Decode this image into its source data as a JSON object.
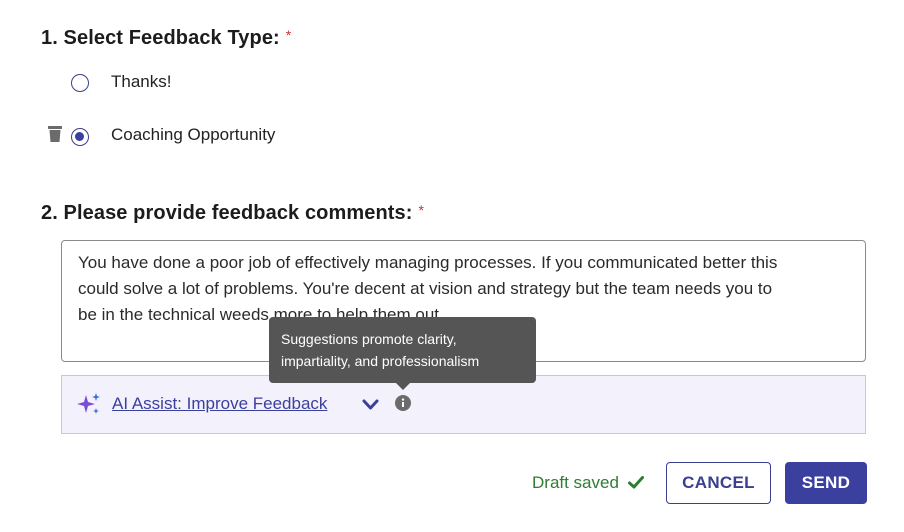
{
  "section1": {
    "title": "1. Select Feedback Type:",
    "required_mark": "*",
    "options": [
      {
        "label": "Thanks!",
        "selected": false
      },
      {
        "label": "Coaching Opportunity",
        "selected": true
      }
    ]
  },
  "section2": {
    "title": "2. Please provide feedback comments:",
    "required_mark": "*",
    "comment_lines": [
      "You have done a poor job of effectively managing processes. If you communicated better this",
      "could solve a lot of problems. You're decent at vision and strategy but the team needs you to",
      "be in the technical weeds more to help them out."
    ]
  },
  "ai_assist": {
    "icon": "sparkle-icon",
    "label": "AI Assist: Improve Feedback",
    "tooltip_lines": [
      "Suggestions promote clarity,",
      "impartiality, and professionalism"
    ]
  },
  "footer": {
    "draft_status": "Draft saved",
    "cancel_label": "CANCEL",
    "send_label": "SEND"
  },
  "colors": {
    "accent": "#3b3f9e",
    "required": "#d0302f",
    "success": "#2e7d32",
    "tooltip_bg": "#555555",
    "ai_bar_bg": "#f3f1fb"
  }
}
